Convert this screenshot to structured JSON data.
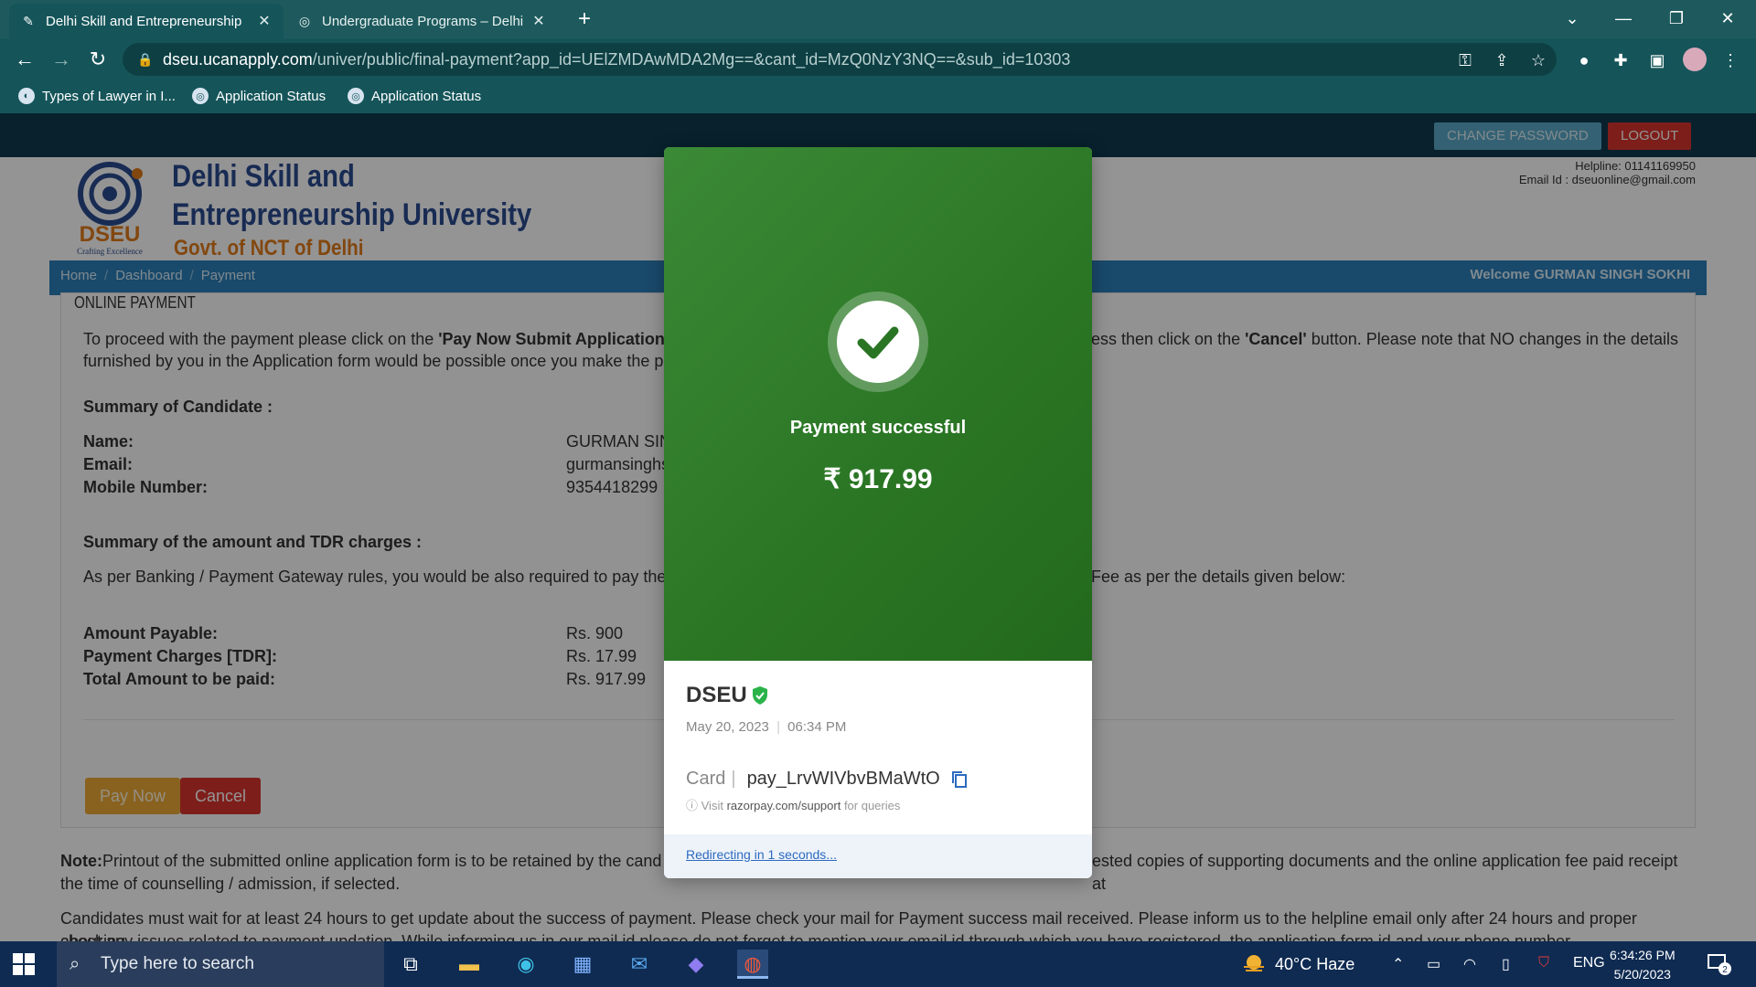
{
  "browser": {
    "tabs": [
      {
        "title": "Delhi Skill and Entrepreneurship",
        "active": true
      },
      {
        "title": "Undergraduate Programs – Delhi",
        "active": false
      }
    ],
    "url_host": "dseu.ucanapply.com",
    "url_path": "/univer/public/final-payment?app_id=UElZMDAwMDA2Mg==&cant_id=MzQ0NzY3NQ==&sub_id=10303",
    "bookmarks": [
      "Types of Lawyer in I...",
      "Application Status",
      "Application Status"
    ]
  },
  "site": {
    "change_password": "CHANGE PASSWORD",
    "logout": "LOGOUT",
    "logo_text": "DSEU",
    "logo_tagline": "Crafting Excellence",
    "uni_line1": "Delhi Skill and",
    "uni_line2": "Entrepreneurship University",
    "govt": "Govt. of NCT of Delhi",
    "helpline": "Helpline: 01141169950",
    "email": "Email Id : dseuonline@gmail.com",
    "breadcrumbs": [
      "Home",
      "Dashboard",
      "Payment"
    ],
    "welcome": "Welcome GURMAN SINGH SOKHI"
  },
  "payment_page": {
    "panel_title": "ONLINE PAYMENT",
    "intro_a": "To proceed with the payment please click on the ",
    "intro_b": "'Pay Now Submit Application'",
    "intro_c": " bu",
    "intro_d": "ess then click on the ",
    "intro_e": "'Cancel'",
    "intro_f": " button. Please note that NO changes in the details",
    "intro_line2": "furnished by you in the Application form would be possible once you make the p",
    "summary_candidate": "Summary of Candidate :",
    "name_label": "Name:",
    "name_value": "GURMAN SIN",
    "email_label": "Email:",
    "email_value": "gurmansinghs",
    "mobile_label": "Mobile Number:",
    "mobile_value": "9354418299",
    "summary_amount": "Summary of the amount and TDR charges :",
    "rules_a": "As per Banking / Payment Gateway rules, you would be also required to pay the c",
    "rules_b": "Fee as per the details given below:",
    "payable_label": "Amount Payable:",
    "payable_value": "Rs. 900",
    "charges_label": "Payment Charges [TDR]:",
    "charges_value": "Rs. 17.99",
    "total_label": "Total Amount to be paid:",
    "total_value": "Rs. 917.99",
    "pay_now": "Pay Now",
    "cancel": "Cancel",
    "note_label": "Note:",
    "note_a": "Printout of the submitted online application form is to be retained by the cand",
    "note_b": "ested copies of supporting documents and the online application fee paid receipt at",
    "note_line2": "the time of counselling / admission, if selected.",
    "wait_text": "Candidates must wait for at least 24 hours to get update about the success of payment. Please check your mail for Payment success mail received. Please inform us to the helpline email only after 24 hours and proper checking",
    "wait_line2": "about any issues related to payment updation. While informing us in our mail id please do not forget to mention your email id through which you have registered, the application form id and your phone number."
  },
  "modal": {
    "status": "Payment successful",
    "amount": "₹ 917.99",
    "merchant": "DSEU",
    "date": "May 20, 2023",
    "time": "06:34 PM",
    "method": "Card",
    "payment_id": "pay_LrvWIVbvBMaWtO",
    "support_prefix": "Visit ",
    "support_link": "razorpay.com/support",
    "support_suffix": " for queries",
    "redirect": "Redirecting in 1 seconds..."
  },
  "taskbar": {
    "search_placeholder": "Type here to search",
    "weather": "40°C  Haze",
    "lang": "ENG",
    "time": "6:34:26 PM",
    "date": "5/20/2023",
    "notifications": "2"
  },
  "colors": {
    "chrome": "#15555a",
    "success_green": "#2a7524",
    "brand_blue": "#2a4a8f",
    "logout_red": "#d9352e"
  }
}
